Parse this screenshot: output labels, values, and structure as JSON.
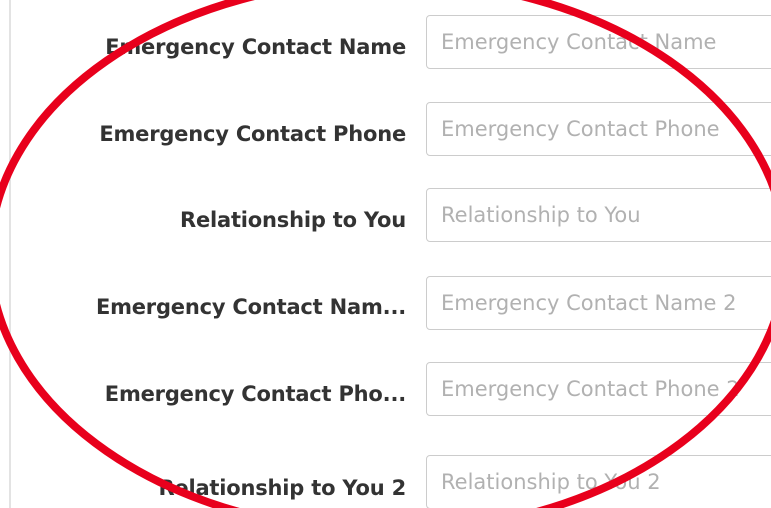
{
  "form": {
    "rows": [
      {
        "label": "Emergency Contact Name",
        "placeholder": "Emergency Contact Name",
        "value": ""
      },
      {
        "label": "Emergency Contact Phone",
        "placeholder": "Emergency Contact Phone",
        "value": ""
      },
      {
        "label": "Relationship to You",
        "placeholder": "Relationship to You",
        "value": ""
      },
      {
        "label": "Emergency Contact Nam...",
        "placeholder": "Emergency Contact Name 2",
        "value": ""
      },
      {
        "label": "Emergency Contact Pho...",
        "placeholder": "Emergency Contact Phone 2",
        "value": ""
      },
      {
        "label": "Relationship to You 2",
        "placeholder": "Relationship to You 2",
        "value": ""
      }
    ]
  },
  "annotation": {
    "shape": "ellipse",
    "color": "#e8001c"
  }
}
